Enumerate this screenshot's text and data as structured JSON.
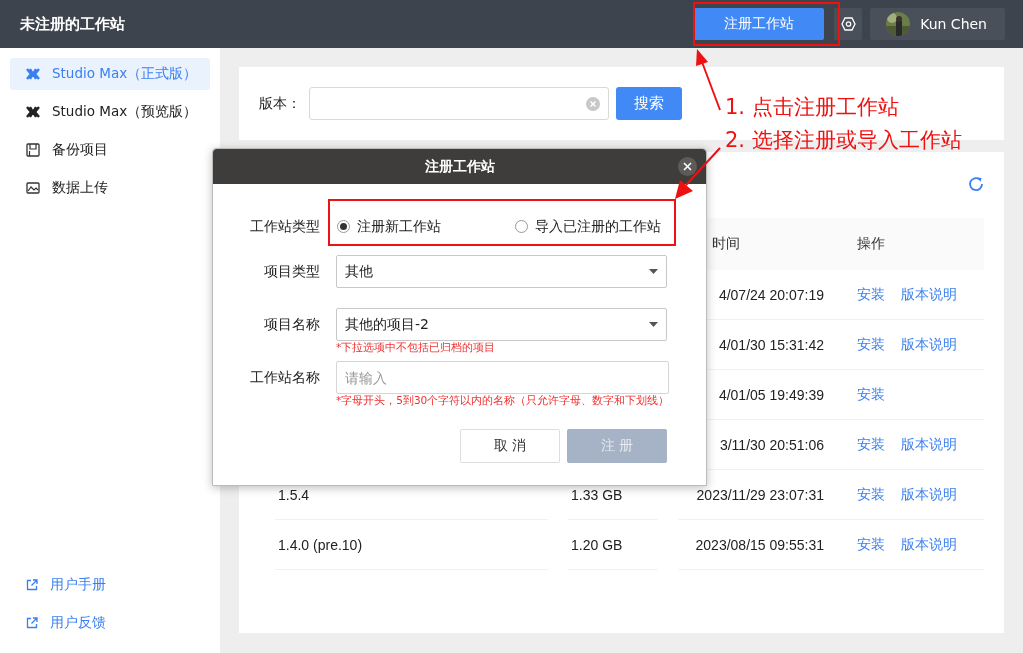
{
  "header": {
    "title": "未注册的工作站",
    "register_button": "注册工作站",
    "user_name": "Kun Chen"
  },
  "sidebar": {
    "items": [
      {
        "label": "Studio Max（正式版）",
        "kind": "logo",
        "selected": true
      },
      {
        "label": "Studio Max（预览版）",
        "kind": "logo",
        "selected": false
      },
      {
        "label": "备份项目",
        "kind": "backup",
        "selected": false
      },
      {
        "label": "数据上传",
        "kind": "upload",
        "selected": false
      }
    ],
    "links": [
      "用户手册",
      "用户反馈"
    ]
  },
  "search": {
    "label": "版本：",
    "button": "搜索"
  },
  "table": {
    "time_header": "时间",
    "actions_header": "操作",
    "rows": [
      {
        "time": "4/07/24 20:07:19",
        "actions": [
          "安装",
          "版本说明"
        ]
      },
      {
        "time": "4/01/30 15:31:42",
        "actions": [
          "安装",
          "版本说明"
        ]
      },
      {
        "time": "4/01/05 19:49:39",
        "actions": [
          "安装"
        ]
      },
      {
        "time": "3/11/30 20:51:06",
        "actions": [
          "安装",
          "版本说明"
        ]
      },
      {
        "version": "1.5.4",
        "size": "1.33 GB",
        "time": "2023/11/29 23:07:31",
        "actions": [
          "安装",
          "版本说明"
        ]
      },
      {
        "version": "1.4.0 (pre.10)",
        "size": "1.20 GB",
        "time": "2023/08/15 09:55:31",
        "actions": [
          "安装",
          "版本说明"
        ]
      }
    ]
  },
  "dialog": {
    "title": "注册工作站",
    "type_label": "工作站类型",
    "options": [
      {
        "label": "注册新工作站",
        "selected": true
      },
      {
        "label": "导入已注册的工作站",
        "selected": false
      }
    ],
    "fields": [
      {
        "kind": "select",
        "label": "项目类型",
        "value": "其他"
      },
      {
        "kind": "select",
        "label": "项目名称",
        "value": "其他的项目-2",
        "hint": "*下拉选项中不包括已归档的项目"
      },
      {
        "kind": "input",
        "label": "工作站名称",
        "placeholder": "请输入",
        "hint": "*字母开头，5到30个字符以内的名称（只允许字母、数字和下划线）"
      }
    ],
    "cancel": "取 消",
    "submit": {
      "label": "注 册",
      "disabled": true
    }
  },
  "annotations": [
    "1. 点击注册工作站",
    "2. 选择注册或导入工作站"
  ]
}
